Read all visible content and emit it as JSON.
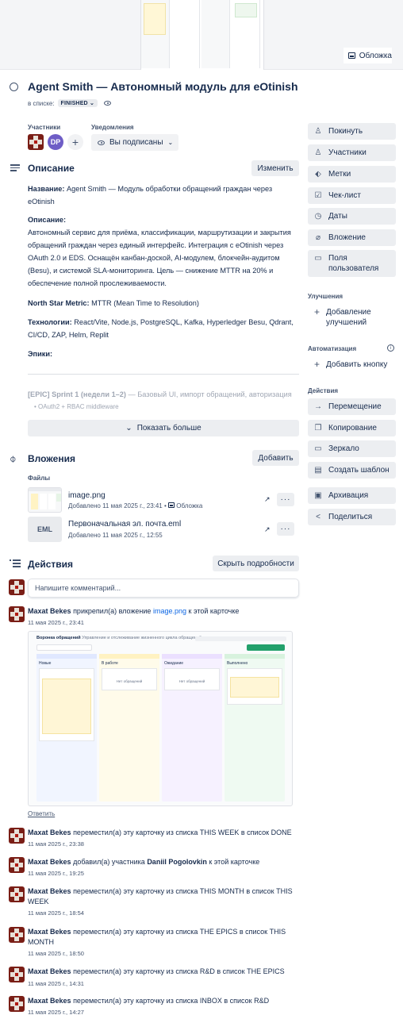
{
  "cover": {
    "button_label": "Обложка"
  },
  "card": {
    "title": "Agent Smith — Автономный модуль для eOtinish",
    "in_list_prefix": "в списке:",
    "list_name": "FINISHED",
    "members_label": "Участники",
    "notifications_label": "Уведомления",
    "member_initials": "DP",
    "watch_label": "Вы подписаны"
  },
  "description": {
    "title": "Описание",
    "edit_label": "Изменить",
    "name_label": "Название:",
    "name_value": "Agent Smith — Модуль обработки обращений граждан через eOtinish",
    "desc_label": "Описание:",
    "desc_value": "Автономный сервис для приёма, классификации, маршрутизации и закрытия обращений граждан через единый интерфейс. Интеграция с eOtinish через OAuth 2.0 и EDS. Оснащён канбан-доской, AI-модулем, блокчейн-аудитом (Besu), и системой SLA-мониторинга. Цель — снижение MTTR на 20% и обеспечение полной прослеживаемости.",
    "nsm_label": "North Star Metric:",
    "nsm_value": "MTTR (Mean Time to Resolution)",
    "tech_label": "Технологии:",
    "tech_value": "React/Vite, Node.js, PostgreSQL, Kafka, Hyperledger Besu, Qdrant, CI/CD, ZAP, Helm, Replit",
    "epics_label": "Эпики:",
    "epic1_label": "[EPIC] Sprint 1 (недели 1–2)",
    "epic1_value": "— Базовый UI, импорт обращений, авторизация",
    "epic1_sub": "OAuth2 + RBAC middleware",
    "show_more": "Показать больше"
  },
  "attachments": {
    "title": "Вложения",
    "add_label": "Добавить",
    "files_label": "Файлы",
    "items": [
      {
        "name": "image.png",
        "meta": "Добавлено 11 мая 2025 г., 23:41 •",
        "tag": "Обложка"
      },
      {
        "name": "Первоначальная эл. почта.eml",
        "meta": "Добавлено 11 мая 2025 г., 12:55",
        "ext": "EML"
      }
    ]
  },
  "activity": {
    "title": "Действия",
    "hide_label": "Скрыть подробности",
    "comment_placeholder": "Напишите комментарий...",
    "reply_label": "Ответить",
    "items": [
      {
        "user": "Maxat Bekes",
        "text": "прикрепил(а) вложение",
        "link": "image.png",
        "tail": "к этой карточке",
        "time": "11 мая 2025 г., 23:41"
      },
      {
        "user": "Maxat Bekes",
        "text": "переместил(а) эту карточку из списка THIS WEEK в список DONE",
        "time": "11 мая 2025 г., 23:38"
      },
      {
        "user": "Maxat Bekes",
        "text": "добавил(а) участника",
        "target": "Daniil Pogolovkin",
        "tail": "к этой карточке",
        "time": "11 мая 2025 г., 19:25"
      },
      {
        "user": "Maxat Bekes",
        "text": "переместил(а) эту карточку из списка THIS MONTH в список THIS WEEK",
        "time": "11 мая 2025 г., 18:54"
      },
      {
        "user": "Maxat Bekes",
        "text": "переместил(а) эту карточку из списка THE EPICS в список THIS MONTH",
        "time": "11 мая 2025 г., 18:50"
      },
      {
        "user": "Maxat Bekes",
        "text": "переместил(а) эту карточку из списка R&D в список THE EPICS",
        "time": "11 мая 2025 г., 14:31"
      },
      {
        "user": "Maxat Bekes",
        "text": "переместил(а) эту карточку из списка INBOX в список R&D",
        "time": "11 мая 2025 г., 14:27"
      }
    ]
  },
  "screenshot": {
    "header": "Воронка обращений",
    "header_sub": "Управление и отслеживание жизненного цикла обращений",
    "columns": [
      "Новые",
      "В работе",
      "Ожидание",
      "Выполнено"
    ],
    "empty_text": "Нет обращений"
  },
  "sidebar": {
    "actions": [
      {
        "icon": "person-icon",
        "label": "Покинуть"
      },
      {
        "icon": "person-icon",
        "label": "Участники"
      },
      {
        "icon": "tag-icon",
        "label": "Метки"
      },
      {
        "icon": "checklist-icon",
        "label": "Чек-лист"
      },
      {
        "icon": "clock-icon",
        "label": "Даты"
      },
      {
        "icon": "paperclip-icon",
        "label": "Вложение"
      },
      {
        "icon": "folder-icon",
        "label": "Поля пользователя"
      }
    ],
    "powerups_label": "Улучшения",
    "add_powerups": "Добавление улучшений",
    "automation_label": "Автоматизация",
    "add_button": "Добавить кнопку",
    "actions_label": "Действия",
    "card_actions": [
      {
        "icon": "arrow-icon",
        "label": "Перемещение"
      },
      {
        "icon": "copy-icon",
        "label": "Копирование"
      },
      {
        "icon": "mirror-icon",
        "label": "Зеркало"
      },
      {
        "icon": "template-icon",
        "label": "Создать шаблон"
      },
      {
        "icon": "archive-icon",
        "label": "Архивация"
      },
      {
        "icon": "share-icon",
        "label": "Поделиться"
      }
    ]
  }
}
